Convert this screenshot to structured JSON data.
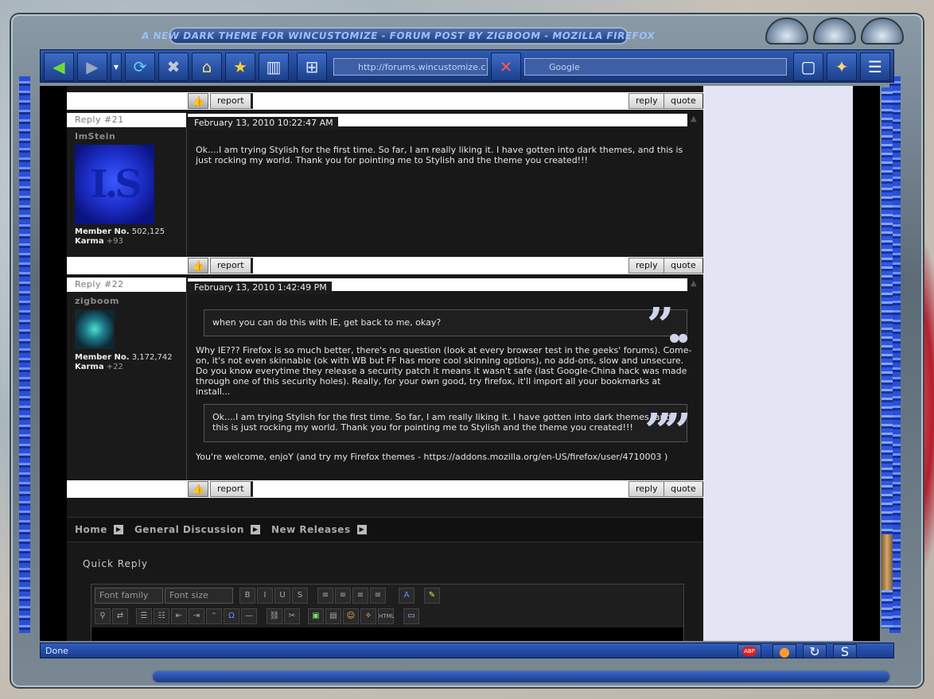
{
  "window": {
    "title": "A new dark theme for WinCustomize - Forum Post by zigboom - Mozilla Firefox"
  },
  "toolbar": {
    "url": "http://forums.wincustomize.c",
    "search_placeholder": "Google"
  },
  "actions": {
    "report": "report",
    "reply": "reply",
    "quote": "quote"
  },
  "posts": [
    {
      "reply_label": "Reply #21",
      "date": "February 13, 2010 10:22:47 AM",
      "username": "ImStein",
      "member_label": "Member No.",
      "member_no": "502,125",
      "karma_label": "Karma",
      "karma": "+93",
      "body": "Ok....I am trying Stylish for the first time. So far, I am really liking it. I have gotten into dark themes, and this is just rocking my world. Thank you for pointing me to Stylish and the theme you created!!!"
    },
    {
      "reply_label": "Reply #22",
      "date": "February 13, 2010 1:42:49 PM",
      "username": "zigboom",
      "member_label": "Member No.",
      "member_no": "3,172,742",
      "karma_label": "Karma",
      "karma": "+22",
      "quote1": "when you can do this with IE, get back to me, okay?",
      "body1": "Why IE??? Firefox is so much better, there's no question (look at every browser test in the geeks' forums). Come-on, it's not even skinnable (ok with WB but FF has more cool skinning options), no add-ons, slow and unsecure. Do you know everytime they release a security patch it means it wasn't safe (last Google-China hack was made through one of this security holes). Really, for your own good, try firefox, it'll import all your bookmarks at install...",
      "quote2": "Ok....I am trying Stylish for the first time. So far, I am really liking it. I have gotten into dark themes, and this is just rocking my world. Thank you for pointing me to Stylish and the theme you created!!!",
      "body2": "You're welcome, enjoY (and try my Firefox themes - https://addons.mozilla.org/en-US/firefox/user/4710003 )"
    }
  ],
  "breadcrumb": [
    "Home",
    "General Discussion",
    "New Releases"
  ],
  "quick_reply": {
    "title": "Quick Reply",
    "font_family": "Font family",
    "font_size": "Font size"
  },
  "status": {
    "text": "Done"
  },
  "colors": {
    "frame": "#5d6b77",
    "toolbar": "#2e5ab0",
    "post_bg": "#181818",
    "sidebar_bg": "#e3e4f4"
  }
}
